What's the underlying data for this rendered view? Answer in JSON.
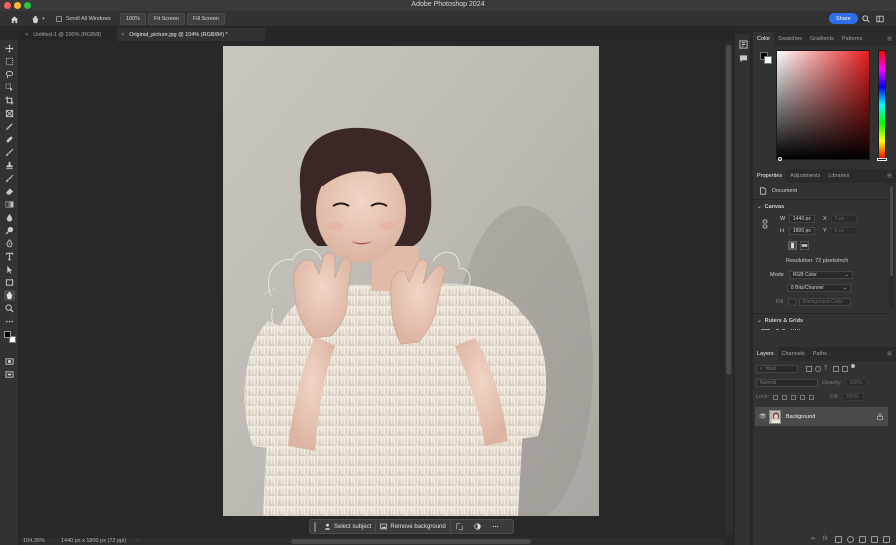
{
  "app": {
    "title": "Adobe Photoshop 2024"
  },
  "options_bar": {
    "scroll_all_windows": "Scroll All Windows",
    "zoom_value": "100%",
    "fit_screen": "Fit Screen",
    "fill_screen": "Fill Screen",
    "share": "Share"
  },
  "tabs": [
    {
      "label": "Untitled-1 @ 100% (RGB/8)",
      "active": false
    },
    {
      "label": "Original_picture.jpg @ 104% (RGB/8#) *",
      "active": true
    }
  ],
  "context_bar": {
    "select_subject": "Select subject",
    "remove_background": "Remove background"
  },
  "status_bar": {
    "zoom": "104.39%",
    "doc_info": "1440 px x 1800 px (72 ppi)"
  },
  "color_panel": {
    "tabs": [
      "Color",
      "Swatches",
      "Gradients",
      "Patterns"
    ],
    "foreground": "#000000",
    "background": "#ffffff",
    "hue_color": "#e51d1d"
  },
  "properties_panel": {
    "tabs": [
      "Properties",
      "Adjustments",
      "Libraries"
    ],
    "document_label": "Document",
    "canvas_section": "Canvas",
    "width_label": "W",
    "width_value": "1440 px",
    "height_label": "H",
    "height_value": "1800 px",
    "x_label": "X",
    "y_label": "Y",
    "x_value": "0 px",
    "y_value": "0 px",
    "resolution": "Resolution: 72 pixels/inch",
    "mode_label": "Mode",
    "mode_value": "RGB Color",
    "bits_value": "8 Bits/Channel",
    "fill_label": "Fill",
    "fill_value": "Background Color",
    "rulers_section": "Rulers & Grids"
  },
  "layers_panel": {
    "tabs": [
      "Layers",
      "Channels",
      "Paths"
    ],
    "kind_placeholder": "Kind",
    "blend_mode": "Normal",
    "opacity_label": "Opacity:",
    "opacity_value": "100%",
    "lock_label": "Lock:",
    "fill_label": "Fill:",
    "fill_value": "100%",
    "layer_name": "Background"
  }
}
